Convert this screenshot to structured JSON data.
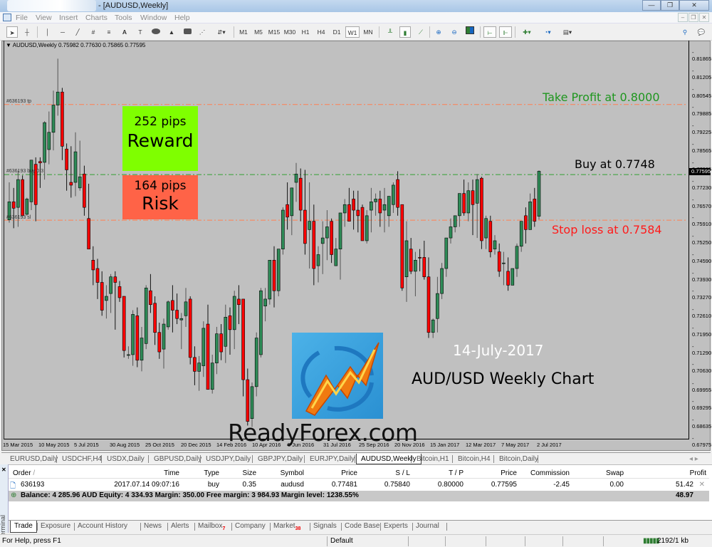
{
  "window": {
    "title": "- [AUDUSD,Weekly]",
    "controls": {
      "minimize": "—",
      "restore": "❐",
      "close": "✕"
    }
  },
  "menu": [
    "File",
    "View",
    "Insert",
    "Charts",
    "Tools",
    "Window",
    "Help"
  ],
  "toolbar": {
    "timeframes": [
      "M1",
      "M5",
      "M15",
      "M30",
      "H1",
      "H4",
      "D1",
      "W1",
      "MN"
    ],
    "active_timeframe": "W1"
  },
  "chart": {
    "header": "AUDUSD,Weekly  0.75982 0.77630 0.75865 0.77595",
    "current_price": "0.77595",
    "order_tags": {
      "tp": "#636193 tp",
      "buy": "#636193 buy 0.3",
      "sl": "#636193 sl"
    },
    "reward_box": {
      "pips": "252 pips",
      "label": "Reward",
      "color": "#7fff00"
    },
    "risk_box": {
      "pips": "164 pips",
      "label": "Risk",
      "color": "#ff6347"
    },
    "annotations": {
      "take_profit": "Take Profit at 0.8000",
      "buy": "Buy at 0.7748",
      "stop_loss": "Stop loss at 0.7584",
      "date": "14-July-2017",
      "title": "AUD/USD Weekly Chart",
      "watermark": "ReadyForex.com"
    },
    "colors": {
      "bull": "#2e8b57",
      "bear": "#ff0000",
      "tp_line": "#ff7f50",
      "buy_line": "#32a032",
      "sl_line": "#ff7f50",
      "tp_text": "#1e961e",
      "sl_text": "#ff1a1a",
      "background": "#c0c0c0"
    }
  },
  "chart_data": {
    "type": "candlestick",
    "title": "AUDUSD,Weekly",
    "ylim": [
      0.67975,
      0.81865
    ],
    "y_ticks": [
      "0.81865",
      "0.81205",
      "0.80545",
      "0.79885",
      "0.79225",
      "0.78565",
      "0.77905",
      "0.77230",
      "0.76570",
      "0.75910",
      "0.75250",
      "0.74590",
      "0.73930",
      "0.73270",
      "0.72610",
      "0.71950",
      "0.71290",
      "0.70630",
      "0.69955",
      "0.69295",
      "0.68635",
      "0.67975"
    ],
    "x_ticks": [
      "15 Mar 2015",
      "10 May 2015",
      "5 Jul 2015",
      "30 Aug 2015",
      "25 Oct 2015",
      "20 Dec 2015",
      "14 Feb 2016",
      "10 Apr 2016",
      "5 Jun 2016",
      "31 Jul 2016",
      "25 Sep 2016",
      "20 Nov 2016",
      "15 Jan 2017",
      "12 Mar 2017",
      "7 May 2017",
      "2 Jul 2017"
    ],
    "levels": {
      "take_profit": 0.8,
      "buy": 0.77481,
      "stop_loss": 0.7584
    },
    "candles": [
      [
        0.7585,
        0.772,
        0.7575,
        0.765
      ],
      [
        0.765,
        0.77,
        0.7555,
        0.7627
      ],
      [
        0.763,
        0.7762,
        0.756,
        0.773
      ],
      [
        0.773,
        0.7745,
        0.76,
        0.76
      ],
      [
        0.7605,
        0.7665,
        0.76,
        0.766
      ],
      [
        0.765,
        0.7785,
        0.762,
        0.78
      ],
      [
        0.7785,
        0.781,
        0.758,
        0.764
      ],
      [
        0.7795,
        0.781,
        0.77,
        0.779
      ],
      [
        0.7792,
        0.794,
        0.773,
        0.7935
      ],
      [
        0.7838,
        0.7975,
        0.7785,
        0.79
      ],
      [
        0.79,
        0.805,
        0.7835,
        0.7998
      ],
      [
        0.7998,
        0.8165,
        0.796,
        0.8045
      ],
      [
        0.8045,
        0.806,
        0.78,
        0.785
      ],
      [
        0.784,
        0.786,
        0.769,
        0.7765
      ],
      [
        0.772,
        0.785,
        0.7665,
        0.771
      ],
      [
        0.772,
        0.79,
        0.767,
        0.783
      ],
      [
        0.77,
        0.787,
        0.769,
        0.774
      ],
      [
        0.775,
        0.778,
        0.76,
        0.763
      ],
      [
        0.759,
        0.7715,
        0.749,
        0.748
      ],
      [
        0.744,
        0.749,
        0.735,
        0.7405
      ],
      [
        0.741,
        0.7445,
        0.73,
        0.736
      ],
      [
        0.736,
        0.74,
        0.724,
        0.726
      ],
      [
        0.7295,
        0.735,
        0.723,
        0.731
      ],
      [
        0.732,
        0.739,
        0.725,
        0.738
      ],
      [
        0.738,
        0.74,
        0.719,
        0.736
      ],
      [
        0.7345,
        0.7365,
        0.729,
        0.7305
      ],
      [
        0.731,
        0.726,
        0.709,
        0.7115
      ],
      [
        0.71,
        0.713,
        0.7085,
        0.71
      ],
      [
        0.71,
        0.726,
        0.706,
        0.7245
      ],
      [
        0.724,
        0.727,
        0.7055,
        0.708
      ],
      [
        0.708,
        0.72,
        0.704,
        0.716
      ],
      [
        0.714,
        0.735,
        0.712,
        0.734
      ],
      [
        0.733,
        0.739,
        0.725,
        0.728
      ],
      [
        0.7285,
        0.731,
        0.7135,
        0.718
      ],
      [
        0.718,
        0.7215,
        0.7085,
        0.711
      ],
      [
        0.712,
        0.723,
        0.705,
        0.721
      ],
      [
        0.72,
        0.7295,
        0.719,
        0.729
      ],
      [
        0.7295,
        0.735,
        0.718,
        0.726
      ],
      [
        0.726,
        0.732,
        0.721,
        0.723
      ],
      [
        0.7225,
        0.725,
        0.712,
        0.723
      ],
      [
        0.724,
        0.734,
        0.72,
        0.729
      ],
      [
        0.73,
        0.731,
        0.7065,
        0.709
      ],
      [
        0.709,
        0.713,
        0.699,
        0.704
      ],
      [
        0.704,
        0.7095,
        0.697,
        0.707
      ],
      [
        0.706,
        0.722,
        0.702,
        0.7195
      ],
      [
        0.721,
        0.728,
        0.6975,
        0.6975
      ],
      [
        0.6975,
        0.71,
        0.696,
        0.707
      ],
      [
        0.707,
        0.72,
        0.703,
        0.7175
      ],
      [
        0.7175,
        0.721,
        0.708,
        0.711
      ],
      [
        0.713,
        0.728,
        0.707,
        0.7235
      ],
      [
        0.724,
        0.727,
        0.71,
        0.719
      ],
      [
        0.719,
        0.733,
        0.712,
        0.731
      ],
      [
        0.73,
        0.735,
        0.721,
        0.728
      ],
      [
        0.73,
        0.729,
        0.695,
        0.701
      ],
      [
        0.701,
        0.705,
        0.6845,
        0.686
      ],
      [
        0.687,
        0.7,
        0.684,
        0.6985
      ],
      [
        0.6985,
        0.718,
        0.695,
        0.716
      ],
      [
        0.71,
        0.734,
        0.709,
        0.733
      ],
      [
        0.7275,
        0.734,
        0.722,
        0.73
      ],
      [
        0.73,
        0.742,
        0.728,
        0.744
      ],
      [
        0.744,
        0.749,
        0.727,
        0.733
      ],
      [
        0.733,
        0.745,
        0.731,
        0.748
      ],
      [
        0.748,
        0.763,
        0.746,
        0.762
      ],
      [
        0.764,
        0.772,
        0.755,
        0.7595
      ],
      [
        0.76,
        0.77,
        0.753,
        0.77
      ],
      [
        0.772,
        0.779,
        0.765,
        0.775
      ],
      [
        0.7735,
        0.777,
        0.758,
        0.762
      ],
      [
        0.762,
        0.7765,
        0.746,
        0.75
      ],
      [
        0.755,
        0.772,
        0.741,
        0.758
      ],
      [
        0.758,
        0.764,
        0.735,
        0.741
      ],
      [
        0.742,
        0.749,
        0.736,
        0.746
      ],
      [
        0.75,
        0.758,
        0.739,
        0.752
      ],
      [
        0.752,
        0.762,
        0.744,
        0.756
      ],
      [
        0.758,
        0.759,
        0.743,
        0.746
      ],
      [
        0.742,
        0.752,
        0.744,
        0.748
      ],
      [
        0.748,
        0.759,
        0.737,
        0.761
      ],
      [
        0.761,
        0.766,
        0.756,
        0.764
      ],
      [
        0.764,
        0.77,
        0.758,
        0.758
      ],
      [
        0.766,
        0.769,
        0.755,
        0.762
      ],
      [
        0.762,
        0.769,
        0.754,
        0.76
      ],
      [
        0.763,
        0.764,
        0.751,
        0.751
      ],
      [
        0.751,
        0.762,
        0.75,
        0.76
      ],
      [
        0.762,
        0.77,
        0.754,
        0.765
      ],
      [
        0.765,
        0.768,
        0.76,
        0.766
      ],
      [
        0.766,
        0.769,
        0.756,
        0.761
      ],
      [
        0.762,
        0.77,
        0.754,
        0.764
      ],
      [
        0.76,
        0.766,
        0.756,
        0.767
      ],
      [
        0.764,
        0.772,
        0.761,
        0.771
      ],
      [
        0.773,
        0.776,
        0.76,
        0.763
      ],
      [
        0.764,
        0.757,
        0.733,
        0.734
      ],
      [
        0.738,
        0.758,
        0.729,
        0.751
      ],
      [
        0.748,
        0.752,
        0.739,
        0.74
      ],
      [
        0.74,
        0.747,
        0.731,
        0.744
      ],
      [
        0.745,
        0.748,
        0.74,
        0.7448
      ],
      [
        0.745,
        0.751,
        0.737,
        0.738
      ],
      [
        0.738,
        0.745,
        0.716,
        0.718
      ],
      [
        0.718,
        0.723,
        0.716,
        0.7225
      ],
      [
        0.723,
        0.738,
        0.718,
        0.732
      ],
      [
        0.732,
        0.743,
        0.73,
        0.741
      ],
      [
        0.741,
        0.748,
        0.738,
        0.752
      ],
      [
        0.752,
        0.759,
        0.75,
        0.756
      ],
      [
        0.756,
        0.76,
        0.754,
        0.76
      ],
      [
        0.76,
        0.765,
        0.756,
        0.768
      ],
      [
        0.768,
        0.773,
        0.76,
        0.761
      ],
      [
        0.761,
        0.772,
        0.758,
        0.769
      ],
      [
        0.769,
        0.773,
        0.753,
        0.764
      ],
      [
        0.7645,
        0.775,
        0.752,
        0.773
      ],
      [
        0.7735,
        0.774,
        0.748,
        0.751
      ],
      [
        0.752,
        0.76,
        0.748,
        0.759
      ],
      [
        0.758,
        0.76,
        0.745,
        0.747
      ],
      [
        0.748,
        0.753,
        0.746,
        0.751
      ],
      [
        0.747,
        0.75,
        0.738,
        0.74
      ],
      [
        0.743,
        0.747,
        0.735,
        0.743
      ],
      [
        0.74,
        0.745,
        0.733,
        0.735
      ],
      [
        0.735,
        0.74,
        0.737,
        0.741
      ],
      [
        0.741,
        0.75,
        0.738,
        0.749
      ],
      [
        0.749,
        0.756,
        0.747,
        0.758
      ],
      [
        0.76,
        0.763,
        0.75,
        0.755
      ],
      [
        0.755,
        0.768,
        0.755,
        0.765
      ],
      [
        0.766,
        0.77,
        0.756,
        0.758
      ],
      [
        0.7598,
        0.7763,
        0.7586,
        0.776
      ]
    ]
  },
  "symbol_tabs": {
    "items": [
      "EURUSD,Daily",
      "USDCHF,H4",
      "USDX,Daily",
      "GBPUSD,Daily",
      "USDJPY,Daily",
      "GBPJPY,Daily",
      "EURJPY,Daily",
      "AUDUSD,Weekly",
      "Bitcoin,H1",
      "Bitcoin,H4",
      "Bitcoin,Daily"
    ],
    "active": "AUDUSD,Weekly"
  },
  "terminal": {
    "label": "Terminal",
    "columns": [
      "Order",
      "Time",
      "Type",
      "Size",
      "Symbol",
      "Price",
      "S / L",
      "T / P",
      "Price",
      "Commission",
      "Swap",
      "Profit"
    ],
    "rows": [
      {
        "order": "636193",
        "time": "2017.07.14 09:07:16",
        "type": "buy",
        "size": "0.35",
        "symbol": "audusd",
        "price": "0.77481",
        "sl": "0.75840",
        "tp": "0.80000",
        "cur_price": "0.77595",
        "commission": "-2.45",
        "swap": "0.00",
        "profit": "51.42"
      }
    ],
    "balance_line": "Balance: 4 285.96 AUD  Equity: 4 334.93  Margin: 350.00  Free margin: 3 984.93  Margin level: 1238.55%",
    "total_profit": "48.97",
    "tabs": [
      "Trade",
      "Exposure",
      "Account History",
      "News",
      "Alerts",
      "Mailbox",
      "Company",
      "Market",
      "Signals",
      "Code Base",
      "Experts",
      "Journal"
    ],
    "active_tab": "Trade",
    "badges": {
      "mailbox": "7",
      "market": "38"
    }
  },
  "status": {
    "help": "For Help, press F1",
    "profile": "Default",
    "traffic": "2192/1 kb"
  }
}
